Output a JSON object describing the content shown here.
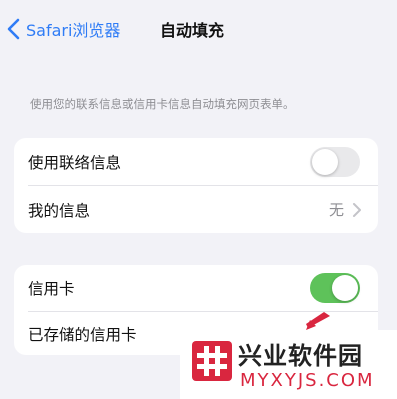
{
  "nav": {
    "back_label": "Safari浏览器",
    "title": "自动填充"
  },
  "description": "使用您的联系信息或信用卡信息自动填充网页表单。",
  "section_contact": {
    "use_contact_label": "使用联络信息",
    "use_contact_on": false,
    "my_info_label": "我的信息",
    "my_info_value": "无"
  },
  "section_card": {
    "credit_card_label": "信用卡",
    "credit_card_on": true,
    "saved_cards_label": "已存储的信用卡"
  },
  "watermark": {
    "title": "兴业软件园",
    "domain": "MYXYJS.COM"
  },
  "colors": {
    "accent": "#2f7cf6",
    "toggle_on": "#5ec25a",
    "toggle_off": "#e9e9eb",
    "watermark_red": "#d9263f"
  }
}
